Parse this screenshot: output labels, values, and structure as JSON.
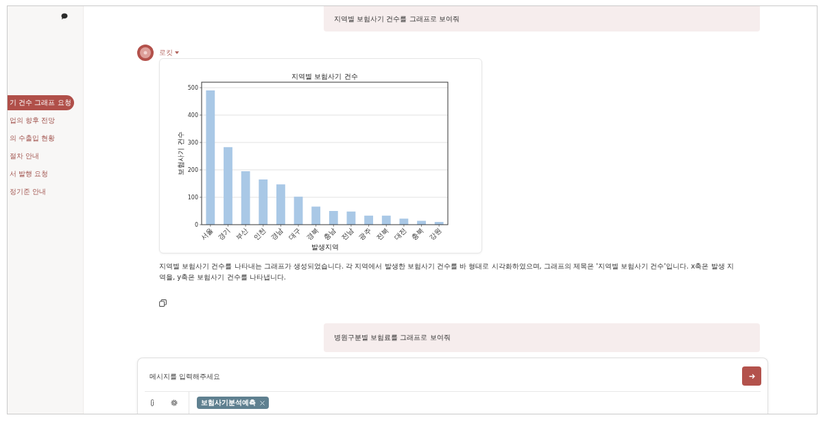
{
  "sidebar": {
    "items": [
      {
        "label": "기 건수 그래프 요청",
        "selected": true
      },
      {
        "label": "업의 향후 전망",
        "selected": false
      },
      {
        "label": "의 수출입 현황",
        "selected": false
      },
      {
        "label": "절차 안내",
        "selected": false
      },
      {
        "label": "서 발행 요청",
        "selected": false
      },
      {
        "label": "정기준 안내",
        "selected": false
      }
    ]
  },
  "messages": [
    {
      "kind": "user",
      "text": "지역별 보험사기 건수를 그래프로 보여줘"
    },
    {
      "kind": "assistant",
      "name": "로킷",
      "chart_data": {
        "type": "bar",
        "title": "지역별 보험사기 건수",
        "xlabel": "발생지역",
        "ylabel": "보험사기 건수",
        "categories": [
          "서울",
          "경기",
          "부산",
          "인천",
          "경남",
          "대구",
          "경북",
          "충남",
          "전남",
          "광주",
          "전북",
          "대전",
          "충북",
          "강원"
        ],
        "values": [
          490,
          283,
          195,
          165,
          147,
          102,
          66,
          50,
          48,
          33,
          33,
          22,
          14,
          10
        ],
        "ylim": [
          0,
          520
        ],
        "yticks": [
          0,
          100,
          200,
          300,
          400,
          500
        ],
        "grid": true
      },
      "text": "지역별 보험사기 건수를 나타내는 그래프가 생성되었습니다. 각 지역에서 발생한 보험사기 건수를 바 형태로 시각화하였으며, 그래프의 제목은 '지역별 보험사기 건수'입니다. x축은 발생 지역을, y축은 보험사기 건수를 나타냅니다."
    },
    {
      "kind": "user",
      "text": "병원구분별 보험료를 그래프로 보여줘"
    }
  ],
  "composer": {
    "placeholder": "메시지를 입력해주세요",
    "tags": [
      {
        "label": "보험사기분석예측"
      }
    ]
  }
}
